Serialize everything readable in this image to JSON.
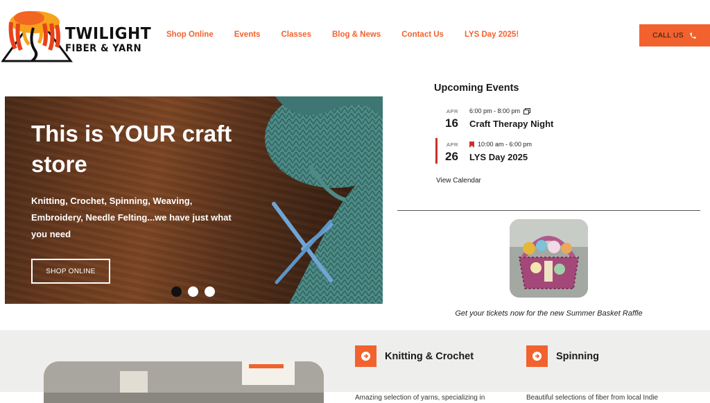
{
  "brand": {
    "name_line1": "TWILIGHT",
    "name_line2": "FIBER & YARN",
    "accent": "#f2622e"
  },
  "nav": {
    "items": [
      "Shop Online",
      "Events",
      "Classes",
      "Blog & News",
      "Contact Us",
      "LYS Day 2025!"
    ]
  },
  "header": {
    "call_label": "CALL US",
    "call_icon": "phone-icon"
  },
  "hero": {
    "title": "This is YOUR craft store",
    "subtitle": "Knitting, Crochet, Spinning, Weaving, Embroidery, Needle Felting...we have just what you need",
    "button": "SHOP ONLINE",
    "slides": 3,
    "active_slide": 1
  },
  "events": {
    "title": "Upcoming Events",
    "items": [
      {
        "month": "APR",
        "day": "16",
        "time": "6:00 pm - 8:00 pm",
        "name": "Craft Therapy Night",
        "icon": "recurring-icon"
      },
      {
        "month": "APR",
        "day": "26",
        "time": "10:00 am - 6:00 pm",
        "name": "LYS Day 2025",
        "icon": "bookmark-icon",
        "featured": true
      }
    ],
    "view_calendar": "View Calendar"
  },
  "raffle": {
    "caption": "Get your tickets now for the new Summer Basket Raffle"
  },
  "features": [
    {
      "title": "Knitting & Crochet",
      "desc": "Amazing selection of yarns, specializing in",
      "icon": "arrow-circle-icon"
    },
    {
      "title": "Spinning",
      "desc": "Beautiful selections of fiber from local Indie",
      "icon": "arrow-circle-icon"
    }
  ]
}
